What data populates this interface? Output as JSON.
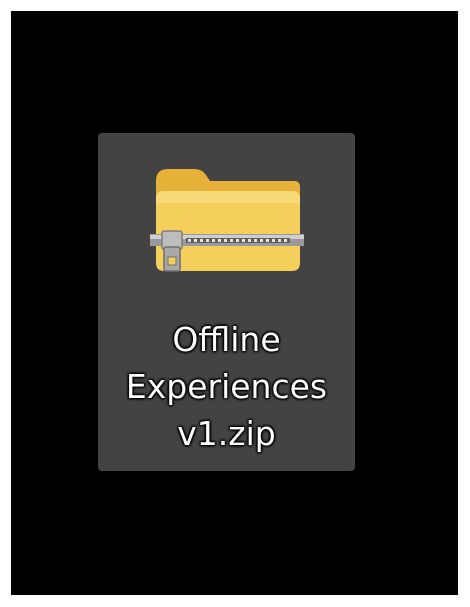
{
  "desktop": {
    "items": [
      {
        "name_lines": [
          "Offline",
          "Experiences",
          "v1.zip"
        ],
        "icon": "zip-folder-icon",
        "selected": true,
        "colors": {
          "tile": "#434343",
          "folder": "#f5cf5b",
          "folder_tab": "#e8b23a",
          "zipper": "#b9b9b9"
        }
      }
    ]
  }
}
